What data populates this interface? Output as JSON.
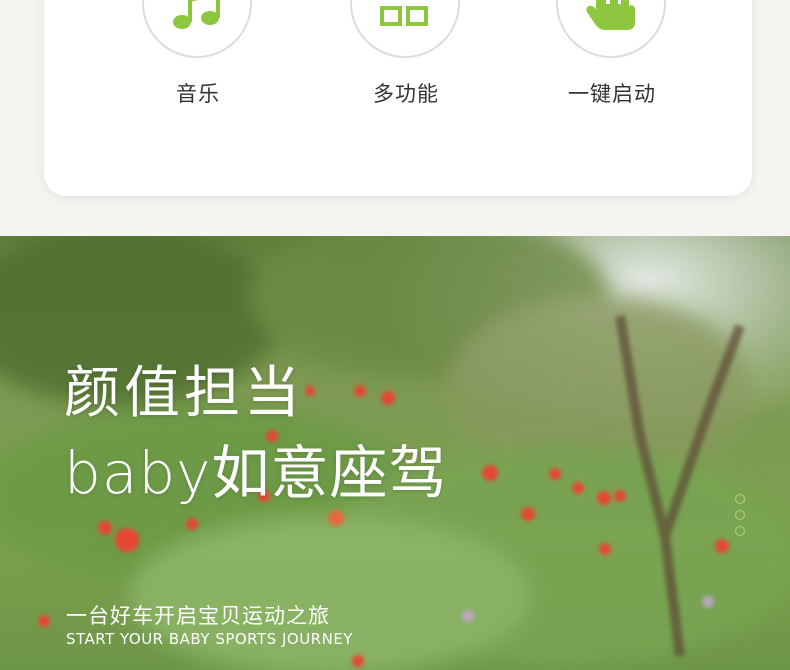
{
  "features": [
    {
      "label": "音乐",
      "icon": "music-note-icon"
    },
    {
      "label": "多功能",
      "icon": "grid-icon"
    },
    {
      "label": "一键启动",
      "icon": "hand-tap-icon"
    }
  ],
  "hero": {
    "headline_line1": "颜值担当",
    "headline_line2": "baby如意座驾",
    "subtitle_cn": "一台好车开启宝贝运动之旅",
    "subtitle_en": "START YOUR BABY SPORTS JOURNEY",
    "carousel_dots": 3
  },
  "colors": {
    "accent_green": "#8dc63f",
    "card_bg": "#ffffff",
    "text_dark": "#333333"
  }
}
